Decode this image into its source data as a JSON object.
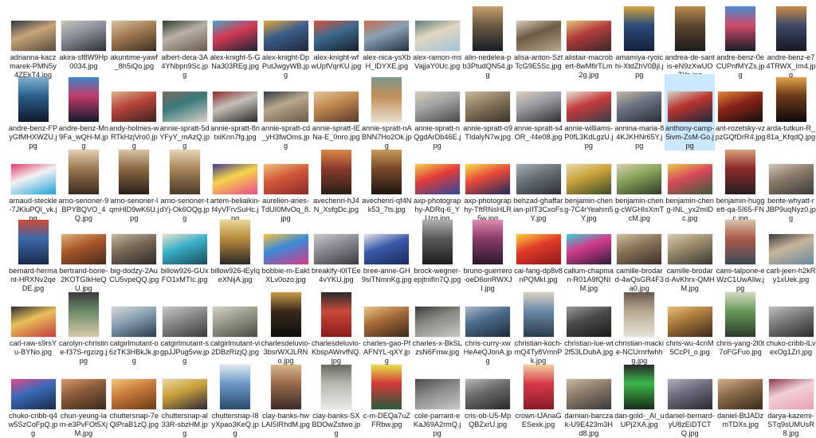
{
  "view": "large-icons",
  "selected_file": "anthony-camp-5ivm-ZsM-Go.jpg",
  "rows": [
    [
      {
        "label": "adrianna-kaczmarek-PMN5y4ZEkT4.jpg",
        "shape": "landscape",
        "palette": [
          "#5a4a3c",
          "#c7a57a",
          "#2e3440"
        ]
      },
      {
        "label": "akira-sf8W9Hp0034.jpg",
        "shape": "landscape",
        "palette": [
          "#2d2f36",
          "#8a8f99",
          "#c9c4bb"
        ]
      },
      {
        "label": "akuntime-yawf_8h5iQo.jpg",
        "shape": "landscape",
        "palette": [
          "#3b2e26",
          "#a37c52",
          "#d8c3a3"
        ]
      },
      {
        "label": "albert-dera-3A4YNbpn9Sc.jpg",
        "shape": "landscape",
        "palette": [
          "#6b5a4b",
          "#b9b2a6",
          "#2f3b2e"
        ]
      },
      {
        "label": "alex-knight-5-GNa303REg.jpg",
        "shape": "landscape",
        "palette": [
          "#1b2437",
          "#d23a53",
          "#4aa3c8"
        ]
      },
      {
        "label": "alex-knight-DpPutJwgyWB.jpg",
        "shape": "landscape",
        "palette": [
          "#1f2a3a",
          "#3c5d8a",
          "#e5a93c"
        ]
      },
      {
        "label": "alex-knight-wfwUpfVqrKU.jpg",
        "shape": "landscape",
        "palette": [
          "#16202e",
          "#3d6a8c",
          "#d9513a"
        ]
      },
      {
        "label": "alex-nica-ysXbH_lDYXE.jpg",
        "shape": "landscape",
        "palette": [
          "#233142",
          "#8aa2b5",
          "#c96b4c"
        ]
      },
      {
        "label": "alex-ramon-msVajjaY0Uc.jpg",
        "shape": "landscape",
        "palette": [
          "#9fc2d8",
          "#e2d7c2",
          "#5c7f7a"
        ]
      },
      {
        "label": "alin-nedelea-pb3PtudQN54.jpg",
        "shape": "portrait",
        "palette": [
          "#1a1e26",
          "#6c5a44",
          "#c8a070"
        ]
      },
      {
        "label": "alisa-anton-SztTcG9E5Sc.jpg",
        "shape": "landscape",
        "palette": [
          "#b7a58d",
          "#6e5b46",
          "#d7cbb7"
        ]
      },
      {
        "label": "alistair-macrobert-8wMfirTLm2g.jpg",
        "shape": "landscape",
        "palette": [
          "#3a2a2a",
          "#b23b3b",
          "#e8c27a"
        ]
      },
      {
        "label": "amamiya-ryoichi-XtdZhV0Bjl.jpg",
        "shape": "portrait",
        "palette": [
          "#14213d",
          "#2d4a7a",
          "#d4a43a"
        ]
      },
      {
        "label": "andrea-de-santis-eN9zXwUOZYo.jpg",
        "shape": "portrait",
        "palette": [
          "#1e1b18",
          "#5b4630",
          "#b88a4f"
        ]
      },
      {
        "label": "andre-benz-0eCUPnfMYZs.jpg",
        "shape": "portrait",
        "palette": [
          "#1b1d2a",
          "#d04a6a",
          "#4a8ad0"
        ]
      },
      {
        "label": "andre-benz-e74TRWX_Im4.jpg",
        "shape": "portrait",
        "palette": [
          "#151822",
          "#3f4a66",
          "#c98b48"
        ]
      }
    ],
    [
      {
        "label": "andre-benz-FPyGfMHXWZU.jpg",
        "shape": "portrait",
        "palette": [
          "#0f1a2b",
          "#2b5f8c",
          "#7fb0d1"
        ]
      },
      {
        "label": "andre-benz-Mn9Fa_wQH-M.jpg",
        "shape": "portrait",
        "palette": [
          "#151a2e",
          "#c23b6b",
          "#3d86c9"
        ]
      },
      {
        "label": "andy-holmes-wRTkHzjVro0.jpg",
        "shape": "landscape",
        "palette": [
          "#3a2420",
          "#b8453a",
          "#d9b38a"
        ]
      },
      {
        "label": "annie-spratt-5dYFyY_mAzQ.jpg",
        "shape": "landscape",
        "palette": [
          "#d6d2c8",
          "#3b7a7a",
          "#7b6a5a"
        ]
      },
      {
        "label": "annie-spratt-8ntxiKnn7fg.jpg",
        "shape": "landscape",
        "palette": [
          "#2a2a2a",
          "#c4c0b8",
          "#8a2b2b"
        ]
      },
      {
        "label": "annie-spratt-cd_yH3fwOms.jpg",
        "shape": "landscape",
        "palette": [
          "#6a5846",
          "#b8a88e",
          "#2e3a44"
        ]
      },
      {
        "label": "annie-spratt-IENa-E_0nro.jpg",
        "shape": "landscape",
        "palette": [
          "#5a3a2a",
          "#c08850",
          "#e2c69a"
        ]
      },
      {
        "label": "annie-spratt-nABNN7Ho2Ok.jpg",
        "shape": "portrait",
        "palette": [
          "#e7dfc9",
          "#c28f5a",
          "#7a9a8a"
        ]
      },
      {
        "label": "annie-spratt-nQgdArDb46E.jpg",
        "shape": "landscape",
        "palette": [
          "#4a4a4a",
          "#a3a3a3",
          "#d6cdbd"
        ]
      },
      {
        "label": "annie-spratt-o9TIdalyN7w.jpg",
        "shape": "landscape",
        "palette": [
          "#3a3228",
          "#8c7a60",
          "#c9b99a"
        ]
      },
      {
        "label": "annie-spratt-s4OR_-f4e08.jpg",
        "shape": "landscape",
        "palette": [
          "#2f2f35",
          "#9a9aa0",
          "#d8cfc0"
        ]
      },
      {
        "label": "annie-williams-P0fL3KdLgzU.jpg",
        "shape": "landscape",
        "palette": [
          "#3b3f4a",
          "#c43b3b",
          "#e6e1d6"
        ]
      },
      {
        "label": "annina-maria-84KJKHNr65Y.jpg",
        "shape": "landscape",
        "palette": [
          "#2b2f38",
          "#6a7382",
          "#c4b8a4"
        ]
      },
      {
        "label": "anthony-camp-5ivm-ZsM-Go.jpg",
        "shape": "landscape",
        "palette": [
          "#1f2a3a",
          "#b8342f",
          "#d6d0c4"
        ]
      },
      {
        "label": "ant-rozetsky-vzpzGQfDrR4.jpg",
        "shape": "landscape",
        "palette": [
          "#180f0d",
          "#8a2418",
          "#e08a3a"
        ]
      },
      {
        "label": "arda-tutkun-R_81a_KfqdQ.jpg",
        "shape": "portrait",
        "palette": [
          "#0e0b0a",
          "#6b3a1a",
          "#e3a24a"
        ]
      }
    ],
    [
      {
        "label": "arnaud-steckle-7JKluPQl_vk.jpg",
        "shape": "landscape",
        "palette": [
          "#1da3d6",
          "#f2f2f2",
          "#e23a6a"
        ]
      },
      {
        "label": "arno-senoner-9BPYBQVO_4Q.jpg",
        "shape": "portrait",
        "palette": [
          "#3a2a1e",
          "#9c7a52",
          "#e0d0b0"
        ]
      },
      {
        "label": "arno-senoner-lqmHlD9wK6U.jpg",
        "shape": "portrait",
        "palette": [
          "#2a2018",
          "#8a6a44",
          "#d8c4a2"
        ]
      },
      {
        "label": "arno-senoner-tdYj-Ok6OQg.jpg",
        "shape": "portrait",
        "palette": [
          "#4a3a2a",
          "#a8865a",
          "#e6d6b6"
        ]
      },
      {
        "label": "artem-beliaikin-f4yVFrvSuHc.jpg",
        "shape": "landscape",
        "palette": [
          "#e94b8a",
          "#f6d34a",
          "#3b3b8a"
        ]
      },
      {
        "label": "aurelien-aries-TdUI0MvOq_8.jpg",
        "shape": "landscape",
        "palette": [
          "#8a2a2a",
          "#d25a3a",
          "#f0c27a"
        ]
      },
      {
        "label": "avechenri-hJ4N_XsfgDc.jpg",
        "shape": "portrait",
        "palette": [
          "#2a1e1a",
          "#8a3a2a",
          "#d88a4a"
        ]
      },
      {
        "label": "avechenri-qf4Nk53_7ts.jpg",
        "shape": "portrait",
        "palette": [
          "#1e1612",
          "#7a4a2a",
          "#c89a5a"
        ]
      },
      {
        "label": "axp-photography-ADRq-6_YUzg.jpg",
        "shape": "landscape",
        "palette": [
          "#2a4a9a",
          "#e23a3a",
          "#f2d24a"
        ]
      },
      {
        "label": "axp-photography-TftRNsHLR5w.jpg",
        "shape": "landscape",
        "palette": [
          "#1e2a5a",
          "#e84a3a",
          "#f6e04a"
        ]
      },
      {
        "label": "behzad-ghaffarian-pIIT3CxoFsY.jpg",
        "shape": "landscape",
        "palette": [
          "#2a2e34",
          "#6a7078",
          "#a8aeb4"
        ]
      },
      {
        "label": "benjamin-cheng-7C4rYeahm5Y.jpg",
        "shape": "landscape",
        "palette": [
          "#3a4a2a",
          "#c8a23a",
          "#e8d8a8"
        ]
      },
      {
        "label": "benjamin-cheng-cWGHIsXmTcM.jpg",
        "shape": "landscape",
        "palette": [
          "#2e3a2a",
          "#8aa25a",
          "#d8d0b0"
        ]
      },
      {
        "label": "benjamin-cheng-INL_yx2mIDc.jpg",
        "shape": "landscape",
        "palette": [
          "#3a5a3a",
          "#d84a5a",
          "#e8c84a"
        ]
      },
      {
        "label": "benjamin-huggett-qa-5I65-FNc.jpg",
        "shape": "portrait",
        "palette": [
          "#2a1e1e",
          "#8a2a2a",
          "#d8a07a"
        ]
      },
      {
        "label": "bente-whyatt-rJBP9uqNyz0.jpg",
        "shape": "landscape",
        "palette": [
          "#3a3a3a",
          "#8a7a6a",
          "#d0c6b6"
        ]
      }
    ],
    [
      {
        "label": "bernard-hermant-HRXNv2qeDE.jpg",
        "shape": "portrait",
        "palette": [
          "#1a2a4a",
          "#3a6aaa",
          "#d04a3a"
        ]
      },
      {
        "label": "bertrand-borie-2KOTGIkHeQU.jpg",
        "shape": "landscape",
        "palette": [
          "#4a2a1a",
          "#a8582a",
          "#e0b07a"
        ]
      },
      {
        "label": "big-dodzy-2AuCU5vpeQQ.jpg",
        "shape": "landscape",
        "palette": [
          "#2e2a26",
          "#7a6a58",
          "#c6b8a2"
        ]
      },
      {
        "label": "billow926-GUxFO1xMTIc.jpg",
        "shape": "landscape",
        "palette": [
          "#1a4a5a",
          "#3ab0c8",
          "#e8e0d0"
        ]
      },
      {
        "label": "billow926-lEyIqeXNijA.jpg",
        "shape": "portrait",
        "palette": [
          "#2a2a2a",
          "#b88a3a",
          "#e8d89a"
        ]
      },
      {
        "label": "bobbie-m-EaktXLv0ozo.jpg",
        "shape": "landscape",
        "palette": [
          "#d83a8a",
          "#3a8ad8",
          "#f6c23a"
        ]
      },
      {
        "label": "breakify-i0ITEe4vYKU.jpg",
        "shape": "landscape",
        "palette": [
          "#3a3a3e",
          "#8a8a92",
          "#c8c8cc"
        ]
      },
      {
        "label": "bree-anne-GH9siTNmnKg.jpg",
        "shape": "landscape",
        "palette": [
          "#1a2a5a",
          "#3a5aaa",
          "#e2e2e8"
        ]
      },
      {
        "label": "brock-wegner-epjtnifIn7Q.jpg",
        "shape": "portrait",
        "palette": [
          "#1e1e1e",
          "#5a5a5a",
          "#b0b0b0"
        ]
      },
      {
        "label": "bruno-guerrero-oeD6onRWXJI.jpg",
        "shape": "portrait",
        "palette": [
          "#2a1a2a",
          "#8a3a6a",
          "#e08ab0"
        ]
      },
      {
        "label": "cai-fang-dp8v8nPQMkI.jpg",
        "shape": "landscape",
        "palette": [
          "#8a1a1a",
          "#e23a2a",
          "#f6d23a"
        ]
      },
      {
        "label": "callum-chapman-R01A9fQNIM.jpg",
        "shape": "landscape",
        "palette": [
          "#2a1e3a",
          "#d23a8a",
          "#3ad2d2"
        ]
      },
      {
        "label": "camille-brodard-4wQsGR4F3a0.jpg",
        "shape": "landscape",
        "palette": [
          "#3a3028",
          "#8a7458",
          "#d0c0a0"
        ]
      },
      {
        "label": "camille-brodard-AvKhrx-QMHM.jpg",
        "shape": "landscape",
        "palette": [
          "#3a3a34",
          "#9a8a6a",
          "#d8ccae"
        ]
      },
      {
        "label": "cami-talpone-eWzC1UwAIlw.jpg",
        "shape": "portrait",
        "palette": [
          "#3a4a5a",
          "#aa5a4a",
          "#d8c4aa"
        ]
      },
      {
        "label": "carli-jeen-h2kRy1xUek.jpg",
        "shape": "landscape",
        "palette": [
          "#6a8aa0",
          "#c8b49a",
          "#3a3a3a"
        ]
      }
    ],
    [
      {
        "label": "carl-raw-s9rsYu-BYNo.jpg",
        "shape": "landscape",
        "palette": [
          "#c23a3a",
          "#e8c05a",
          "#2a2a2a"
        ]
      },
      {
        "label": "carolyn-christine-f37S-rgzizg.jpg",
        "shape": "portrait",
        "palette": [
          "#d8c8a8",
          "#6a8a6a",
          "#3a3a3a"
        ]
      },
      {
        "label": "catgirlmutant-o6zTK3HBkJk.jpg",
        "shape": "landscape",
        "palette": [
          "#2a3a4a",
          "#8aa2b2",
          "#d8d8d8"
        ]
      },
      {
        "label": "catgirlmutant-sgpJJPug5vw.jpg",
        "shape": "landscape",
        "palette": [
          "#3a3a3a",
          "#8a8a8a",
          "#c8c8c8"
        ]
      },
      {
        "label": "catgirlmutant-vi2DBzRizjQ.jpg",
        "shape": "landscape",
        "palette": [
          "#4a4a44",
          "#9a9a8a",
          "#d2d0c4"
        ]
      },
      {
        "label": "charlesdeluvio-3bsrWXJLRNo.jpg",
        "shape": "portrait",
        "palette": [
          "#0e0e0e",
          "#3a2a1a",
          "#c89a4a"
        ]
      },
      {
        "label": "charlesdeluvio-KbspAWrvfNQ.jpg",
        "shape": "portrait",
        "palette": [
          "#8a1a1a",
          "#c84a3a",
          "#2a2a2a"
        ]
      },
      {
        "label": "charles-gao-PfAFNYL-qXY.jpg",
        "shape": "landscape",
        "palette": [
          "#3a2a1a",
          "#a86a3a",
          "#e8c88a"
        ]
      },
      {
        "label": "charles-x-BkSLzsN6Fmw.jpg",
        "shape": "landscape",
        "palette": [
          "#c8c8c4",
          "#8a8a84",
          "#3a3a3a"
        ]
      },
      {
        "label": "chris-curry-xwHeAeQJonA.jpg",
        "shape": "landscape",
        "palette": [
          "#1e2a3a",
          "#4a6a8a",
          "#a8b8c8"
        ]
      },
      {
        "label": "christian-koch-mQ4Ty8VmnPk.jpg",
        "shape": "portrait",
        "palette": [
          "#2a3a4a",
          "#6a8aa8",
          "#d8d0c0"
        ]
      },
      {
        "label": "christian-lue-wt2f53LDubA.jpg",
        "shape": "landscape",
        "palette": [
          "#1a1a1a",
          "#4a4a4a",
          "#9a9a9a"
        ]
      },
      {
        "label": "christian-mackie-NCUrnrfwhhg.jpg",
        "shape": "portrait",
        "palette": [
          "#e8e2d8",
          "#b8a890",
          "#6a5a4a"
        ]
      },
      {
        "label": "chris-wu-4cnM5CcPI_o.jpg",
        "shape": "landscape",
        "palette": [
          "#3a2a1e",
          "#a8763a",
          "#e8c07a"
        ]
      },
      {
        "label": "chris-yang-2l0t7oFGFuo.jpg",
        "shape": "portrait",
        "palette": [
          "#2a3a2a",
          "#6a9a5a",
          "#d0d8c0"
        ]
      },
      {
        "label": "chuko-cribb-lLvexOg1ZrI.jpg",
        "shape": "landscape",
        "palette": [
          "#2a2a2a",
          "#7a7a7a",
          "#c0c0c0"
        ]
      }
    ],
    [
      {
        "label": "chuko-cribb-q4w5SzCoFpQ.jpg",
        "shape": "landscape",
        "palette": [
          "#1a2a4a",
          "#3a6ab8",
          "#e04a8a"
        ]
      },
      {
        "label": "chun-yeung-lam-e3PvFOt5XjM.jpg",
        "shape": "landscape",
        "palette": [
          "#3a2a1e",
          "#8a5a3a",
          "#d89a6a"
        ]
      },
      {
        "label": "chuttersnap-7eQlPraB1zQ.jpg",
        "shape": "landscape",
        "palette": [
          "#6a3a1a",
          "#c87a3a",
          "#f0c87a"
        ]
      },
      {
        "label": "chuttersnap-al33R-sbzHM.jpg",
        "shape": "landscape",
        "palette": [
          "#2a2a3a",
          "#c8a03a",
          "#e8d8a0"
        ]
      },
      {
        "label": "chuttersnap-I8yXpao3KeQ.jpg",
        "shape": "portrait",
        "palette": [
          "#2a4a6a",
          "#6a9ac8",
          "#e0e8f0"
        ]
      },
      {
        "label": "clay-banks-hwLAI5IRhdM.jpg",
        "shape": "portrait",
        "palette": [
          "#3a2a2a",
          "#9a6a4a",
          "#d8b88a"
        ]
      },
      {
        "label": "clay-banks-SXBDOwZstwo.jpg",
        "shape": "portrait",
        "palette": [
          "#e8e8e8",
          "#b8b8b0",
          "#6a6a64"
        ]
      },
      {
        "label": "c-m-DEQa7uZFRbw.jpg",
        "shape": "portrait",
        "palette": [
          "#2a5a3a",
          "#d23a3a",
          "#e8e04a"
        ]
      },
      {
        "label": "cole-parrant-eKaJ69A2rmQ.jpg",
        "shape": "landscape",
        "palette": [
          "#c8c8c8",
          "#8a8a8a",
          "#4a4a4a"
        ]
      },
      {
        "label": "cris-ob-U5-MpQBZxrU.jpg",
        "shape": "landscape",
        "palette": [
          "#2a2a2a",
          "#6a6a6a",
          "#b8b8b8"
        ]
      },
      {
        "label": "crown-tJAnaGESexk.jpg",
        "shape": "portrait",
        "palette": [
          "#8a1a2a",
          "#d83a4a",
          "#f0d0a0"
        ]
      },
      {
        "label": "damian-barczak-U9E423m3Hd8.jpg",
        "shape": "landscape",
        "palette": [
          "#3a3a3a",
          "#8a7a6a",
          "#c8b8a0"
        ]
      },
      {
        "label": "dan-gold-_Al_uUPj2XA.jpg",
        "shape": "portrait",
        "palette": [
          "#1a2a1a",
          "#3ab84a",
          "#2a2a2a"
        ]
      },
      {
        "label": "daniel-bernard-yU8zEiDTCTQ.jpg",
        "shape": "landscape",
        "palette": [
          "#2a2a34",
          "#6a6a7a",
          "#b0b0bc"
        ]
      },
      {
        "label": "daniel-BtJADzmTDXs.jpg",
        "shape": "landscape",
        "palette": [
          "#3a2a1a",
          "#8a6a4a",
          "#d0b08a"
        ]
      },
      {
        "label": "darya-kazemi-STq9sUMUsR8.jpg",
        "shape": "landscape",
        "palette": [
          "#e8a0b0",
          "#f0d0d8",
          "#8a3a4a"
        ]
      }
    ]
  ]
}
